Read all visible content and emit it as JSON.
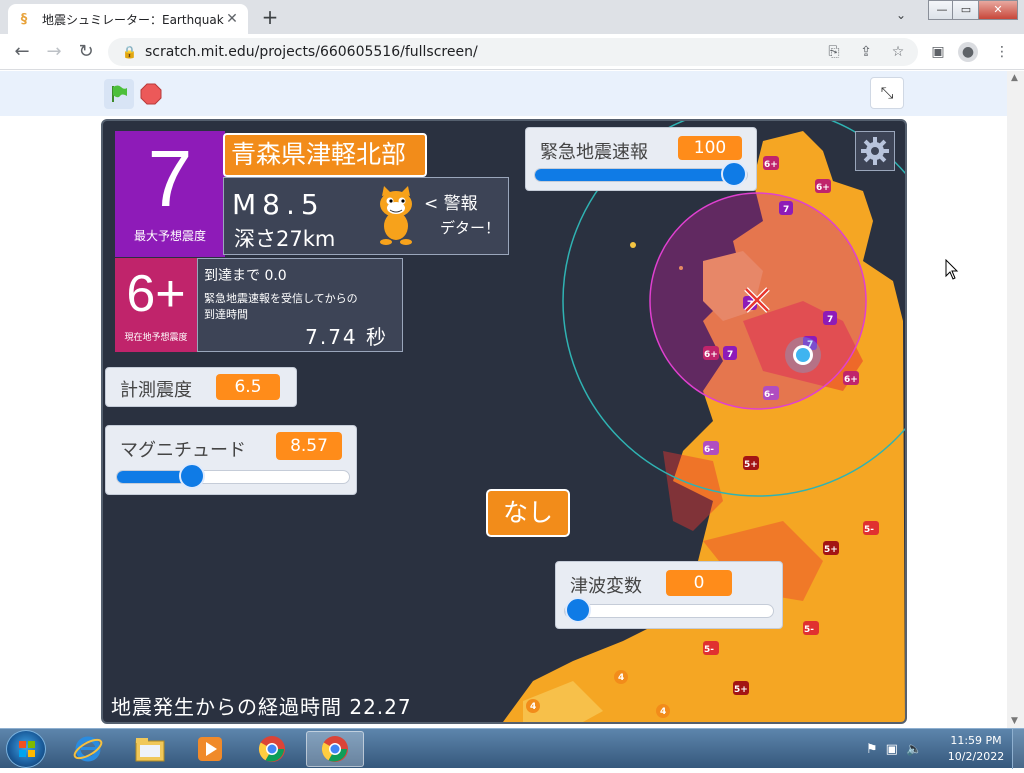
{
  "browser": {
    "tab_title": "地震シュミレーター：Earthquake sir",
    "tab_close": "✕",
    "new_tab": "+",
    "url": "scratch.mit.edu/projects/660605516/fullscreen/",
    "window_controls": {
      "minimize": "—",
      "restore": "▭",
      "close": "✕"
    }
  },
  "scratch": {
    "max_shindo_value": "7",
    "max_shindo_label": "最大予想震度",
    "region": "青森県津軽北部",
    "magnitude_text": "M8.5",
    "depth_text": "深さ27km",
    "warning_text_1": "< 警報",
    "warning_text_2": "デター！",
    "current_shindo_value": "6+",
    "current_shindo_label": "現在地予想震度",
    "arrival_line1": "到達まで 0.0",
    "arrival_line2": "緊急地震速報を受信してからの",
    "arrival_line3": "到達時間",
    "arrival_seconds": "7.74 秒",
    "monitors": {
      "eew": {
        "name": "緊急地震速報",
        "value": "100",
        "slider_fraction": 1.0
      },
      "shindo_measured": {
        "name": "計測震度",
        "value": "6.5"
      },
      "magnitude": {
        "name": "マグニチュード",
        "value": "8.57",
        "slider_fraction": 0.3
      },
      "tsunami": {
        "name": "津波変数",
        "value": "0",
        "slider_fraction": 0.0
      }
    },
    "nashi_button": "なし",
    "elapsed_text": "地震発生からの経過時間 22.27",
    "shindo_markers": [
      "7",
      "6+",
      "6-",
      "5+",
      "5-",
      "4"
    ]
  },
  "taskbar": {
    "time": "11:59 PM",
    "date": "10/2/2022"
  },
  "colors": {
    "stage_bg": "#2a3140",
    "shindo7": "#8e1bb8",
    "shindo6plus": "#c0246b",
    "accent_orange": "#f28c1a",
    "slider_blue": "#0f7be6",
    "land_yellow": "#f5a623"
  }
}
